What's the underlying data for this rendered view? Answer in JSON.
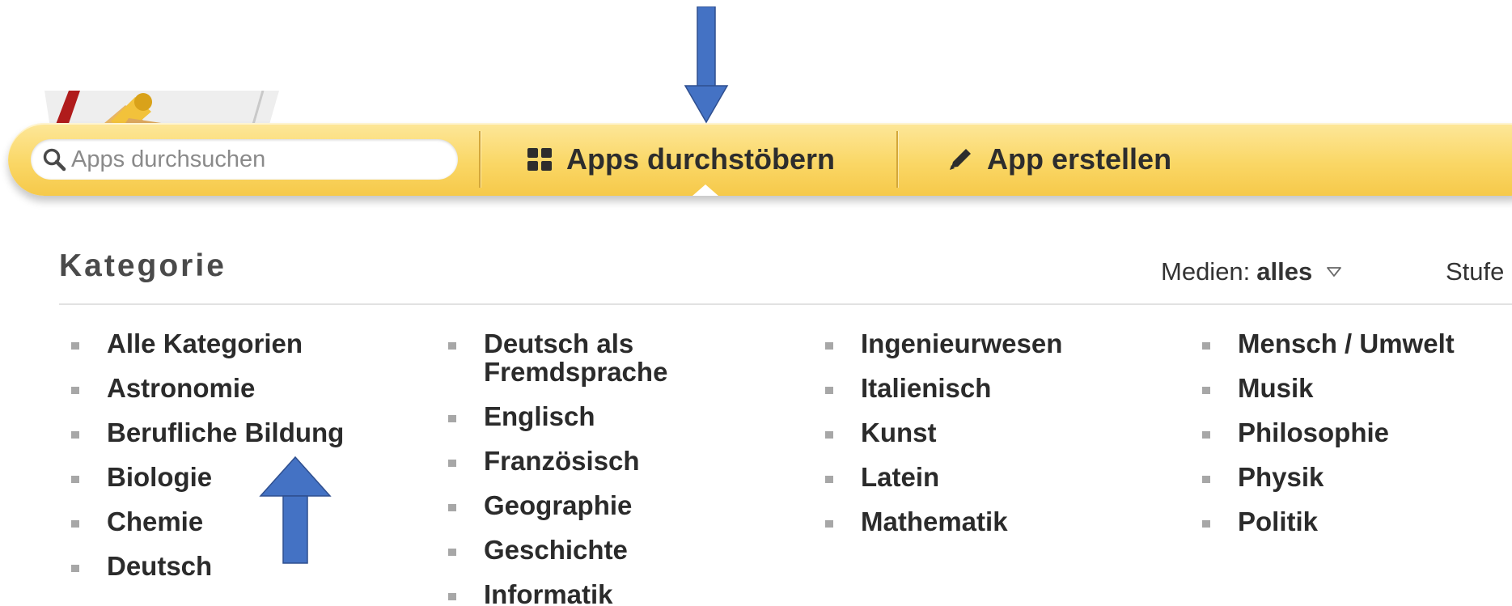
{
  "toolbar": {
    "search": {
      "placeholder": "Apps durchsuchen",
      "value": ""
    },
    "tabs": [
      {
        "label": "Apps durchstöbern",
        "icon": "grid-icon",
        "active": true
      },
      {
        "label": "App erstellen",
        "icon": "pencil-icon",
        "active": false
      }
    ],
    "accent_color": "#fad766"
  },
  "category": {
    "title": "Kategorie",
    "media_filter": {
      "label": "Medien:",
      "value": "alles"
    },
    "level_filter": {
      "label": "Stufe"
    },
    "columns": [
      [
        "Alle Kategorien",
        "Astronomie",
        "Berufliche Bildung",
        "Biologie",
        "Chemie",
        "Deutsch"
      ],
      [
        "Deutsch als Fremdsprache",
        "Englisch",
        "Französisch",
        "Geographie",
        "Geschichte",
        "Informatik"
      ],
      [
        "Ingenieurwesen",
        "Italienisch",
        "Kunst",
        "Latein",
        "Mathematik"
      ],
      [
        "Mensch / Umwelt",
        "Musik",
        "Philosophie",
        "Physik",
        "Politik"
      ]
    ]
  },
  "annotations": {
    "arrow_color": "#4472c4"
  }
}
